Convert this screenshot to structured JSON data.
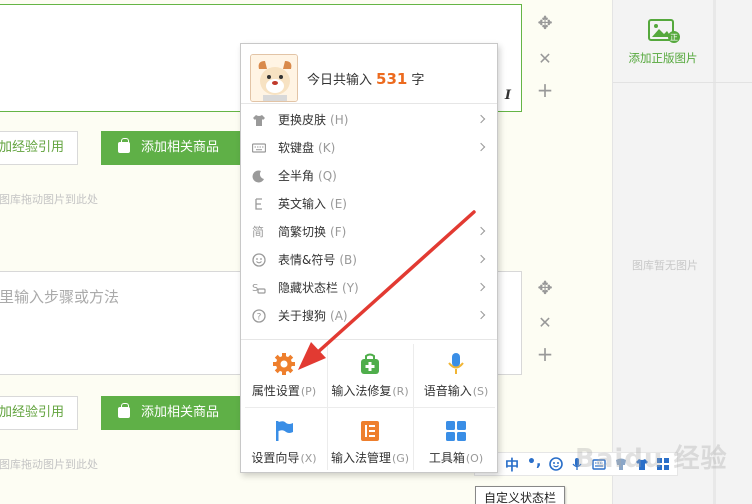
{
  "editor": {
    "step1": {
      "cite_button": "加经验引用",
      "products_button": "添加相关商品",
      "drop_hint": "图库拖动图片到此处"
    },
    "step2": {
      "placeholder": "里输入步骤或方法",
      "cite_button": "加经验引用",
      "products_button": "添加相关商品",
      "drop_hint": "图库拖动图片到此处"
    },
    "italic_label": "I"
  },
  "sidebar": {
    "add_image_label": "添加正版图片",
    "empty_text": "图库暂无图片"
  },
  "ime_menu": {
    "header": {
      "prefix": "今日共输入",
      "count": "531",
      "suffix": "字"
    },
    "items": [
      {
        "label": "更换皮肤",
        "key": "(H)",
        "icon": "shirt-icon",
        "submenu": true
      },
      {
        "label": "软键盘",
        "key": "(K)",
        "icon": "keyboard-icon",
        "submenu": true
      },
      {
        "label": "全半角",
        "key": "(Q)",
        "icon": "moon-icon",
        "submenu": false
      },
      {
        "label": "英文输入",
        "key": "(E)",
        "icon": "english-icon",
        "submenu": false
      },
      {
        "label": "简繁切换",
        "key": "(F)",
        "icon": "jian-icon",
        "icon_text": "简",
        "submenu": true
      },
      {
        "label": "表情&符号",
        "key": "(B)",
        "icon": "smiley-icon",
        "submenu": true
      },
      {
        "label": "隐藏状态栏",
        "key": "(Y)",
        "icon": "hide-statusbar-icon",
        "submenu": true
      },
      {
        "label": "关于搜狗",
        "key": "(A)",
        "icon": "question-icon",
        "submenu": true
      }
    ],
    "grid": [
      {
        "label": "属性设置",
        "key": "(P)",
        "icon": "gear-icon"
      },
      {
        "label": "输入法修复",
        "key": "(R)",
        "icon": "repair-bag-icon"
      },
      {
        "label": "语音输入",
        "key": "(S)",
        "icon": "microphone-icon"
      },
      {
        "label": "设置向导",
        "key": "(X)",
        "icon": "flag-icon"
      },
      {
        "label": "输入法管理",
        "key": "(G)",
        "icon": "manage-icon"
      },
      {
        "label": "工具箱",
        "key": "(O)",
        "icon": "toolbox-icon"
      }
    ]
  },
  "status_bar": {
    "lang": "中",
    "punct": "•,",
    "tooltip": "自定义状态栏"
  },
  "watermark": "Baidu 经验",
  "colors": {
    "accent_green": "#5fb047",
    "count_orange": "#ec6a1e",
    "annotation_red": "#e23a32",
    "ime_blue": "#2a6fc9"
  }
}
